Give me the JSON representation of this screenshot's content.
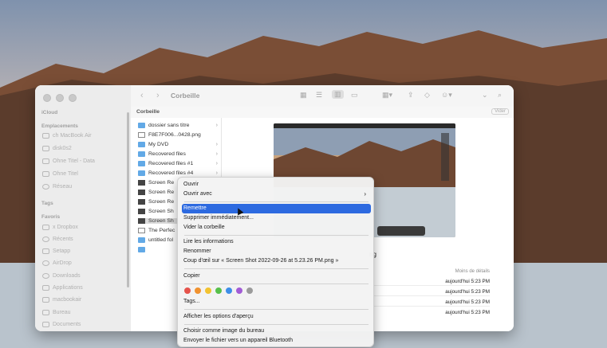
{
  "window": {
    "title": "Corbeille",
    "path_label": "Corbeille",
    "empty_button": "Vider"
  },
  "sidebar": {
    "sections": [
      {
        "label": "iCloud"
      },
      {
        "label": "Emplacements"
      },
      {
        "label": "Tags"
      },
      {
        "label": "Favoris"
      }
    ],
    "locations": [
      "ch MacBook Air",
      "disk0s2",
      "Ohne Titel - Data",
      "Ohne Titel",
      "Réseau"
    ],
    "favorites": [
      "x Dropbox",
      "Récents",
      "Setapp",
      "AirDrop",
      "Downloads",
      "Applications",
      "macbookair",
      "Bureau",
      "Documents"
    ]
  },
  "files": [
    {
      "name": "dossier sans titre",
      "type": "folder",
      "chevron": "›"
    },
    {
      "name": "F8E7F006...0428.png",
      "type": "doc",
      "chevron": ""
    },
    {
      "name": "My DVD",
      "type": "folder",
      "chevron": "›"
    },
    {
      "name": "Recovered files",
      "type": "folder",
      "chevron": "›"
    },
    {
      "name": "Recovered files #1",
      "type": "folder",
      "chevron": "›"
    },
    {
      "name": "Recovered files #4",
      "type": "folder",
      "chevron": "›"
    },
    {
      "name": "Screen Re",
      "type": "img",
      "chevron": ""
    },
    {
      "name": "Screen Re",
      "type": "img",
      "chevron": ""
    },
    {
      "name": "Screen Re",
      "type": "img",
      "chevron": ""
    },
    {
      "name": "Screen Sh",
      "type": "img",
      "chevron": ""
    },
    {
      "name": "Screen Sh",
      "type": "img",
      "chevron": ""
    },
    {
      "name": "The Perfec",
      "type": "doc",
      "chevron": ""
    },
    {
      "name": "untitled fol",
      "type": "folder",
      "chevron": ""
    },
    {
      "name": "",
      "type": "folder",
      "chevron": ""
    }
  ],
  "preview": {
    "name_fragment": "ng",
    "more_details": "Moins de détails",
    "meta": [
      "aujourd'hui 5:23 PM",
      "aujourd'hui 5:23 PM",
      "aujourd'hui 5:23 PM",
      "aujourd'hui 5:23 PM"
    ]
  },
  "menu": {
    "open": "Ouvrir",
    "open_with": "Ouvrir avec",
    "put_back": "Remettre",
    "delete_now": "Supprimer immédiatement...",
    "empty_trash": "Vider la corbeille",
    "get_info": "Lire les informations",
    "rename": "Renommer",
    "quick_look": "Coup d'œil sur « Screen Shot 2022-09-26 at 5.23.26 PM.png »",
    "copy": "Copier",
    "tags": "Tags...",
    "view_options": "Afficher les options d'aperçu",
    "set_desktop": "Choisir comme image du bureau",
    "bluetooth": "Envoyer le fichier vers un appareil Bluetooth",
    "submenu_arrow": "›",
    "tag_colors": [
      "#e5534b",
      "#f0922f",
      "#f2c230",
      "#57c04a",
      "#3d8ee8",
      "#a25cd6",
      "#9b9b9b"
    ]
  }
}
